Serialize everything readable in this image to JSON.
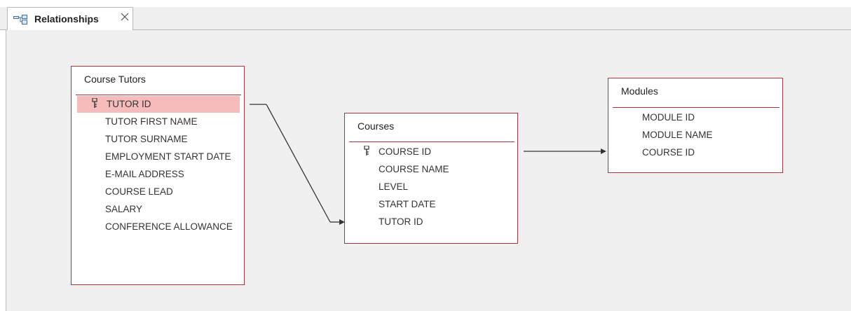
{
  "tab": {
    "title": "Relationships",
    "icon": "relationships-icon",
    "close_icon": "close-icon"
  },
  "colors": {
    "table_border": "#a4373a",
    "selected_row": "#f6bcbc",
    "canvas": "#f0f0f0"
  },
  "tables": {
    "course_tutors": {
      "title": "Course Tutors",
      "fields": [
        "TUTOR ID",
        "TUTOR FIRST NAME",
        "TUTOR SURNAME",
        "EMPLOYMENT START DATE",
        "E-MAIL ADDRESS",
        "COURSE LEAD",
        "SALARY",
        "CONFERENCE ALLOWANCE"
      ],
      "primary_key": "TUTOR ID",
      "selected_field": "TUTOR ID"
    },
    "courses": {
      "title": "Courses",
      "fields": [
        "COURSE ID",
        "COURSE NAME",
        "LEVEL",
        "START DATE",
        "TUTOR ID"
      ],
      "primary_key": "COURSE ID"
    },
    "modules": {
      "title": "Modules",
      "fields": [
        "MODULE ID",
        "MODULE NAME",
        "COURSE ID"
      ]
    }
  },
  "relationships": [
    {
      "from": "Course Tutors.TUTOR ID",
      "to": "Courses.TUTOR ID"
    },
    {
      "from": "Courses.COURSE ID",
      "to": "Modules.COURSE ID"
    }
  ]
}
